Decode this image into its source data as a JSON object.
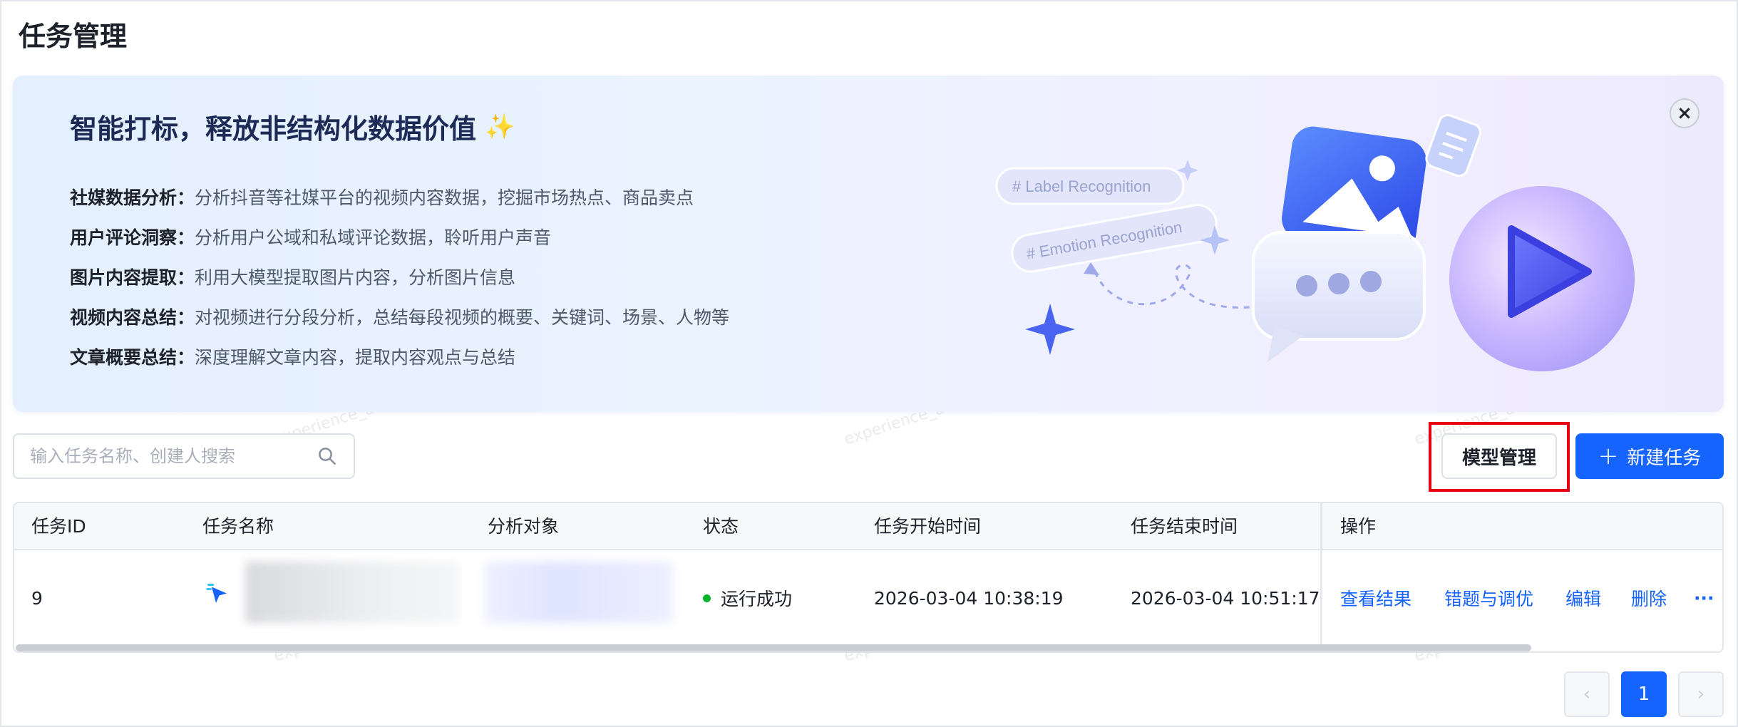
{
  "page": {
    "title": "任务管理"
  },
  "banner": {
    "title": "智能打标，释放非结构化数据价值",
    "sparkle": "✨",
    "close_icon": "close-icon",
    "features": [
      {
        "key": "社媒数据分析：",
        "desc": "分析抖音等社媒平台的视频内容数据，挖掘市场热点、商品卖点"
      },
      {
        "key": "用户评论洞察：",
        "desc": "分析用户公域和私域评论数据，聆听用户声音"
      },
      {
        "key": "图片内容提取：",
        "desc": "利用大模型提取图片内容，分析图片信息"
      },
      {
        "key": "视频内容总结：",
        "desc": "对视频进行分段分析，总结每段视频的概要、关键词、场景、人物等"
      },
      {
        "key": "文章概要总结：",
        "desc": "深度理解文章内容，提取内容观点与总结"
      }
    ],
    "tags": [
      "# Label Recognition",
      "# Emotion Recognition"
    ]
  },
  "toolbar": {
    "search_placeholder": "输入任务名称、创建人搜索",
    "model_manage_label": "模型管理",
    "new_task_label": "新建任务",
    "plus": "+"
  },
  "table": {
    "headers": {
      "id": "任务ID",
      "name": "任务名称",
      "target": "分析对象",
      "status": "状态",
      "start": "任务开始时间",
      "end": "任务结束时间",
      "ops": "操作"
    },
    "rows": [
      {
        "id": "9",
        "status": "运行成功",
        "start": "2026-03-04 10:38:19",
        "end": "2026-03-04 10:51:17",
        "actions": {
          "view": "查看结果",
          "correct": "错题与调优",
          "edit": "编辑",
          "delete": "删除",
          "more": "···"
        }
      }
    ]
  },
  "pagination": {
    "prev": "‹",
    "current": "1",
    "next": "›"
  },
  "watermark": "experience_admin",
  "colors": {
    "primary": "#1664ff",
    "success": "#00b42a",
    "highlight": "#e60012"
  }
}
